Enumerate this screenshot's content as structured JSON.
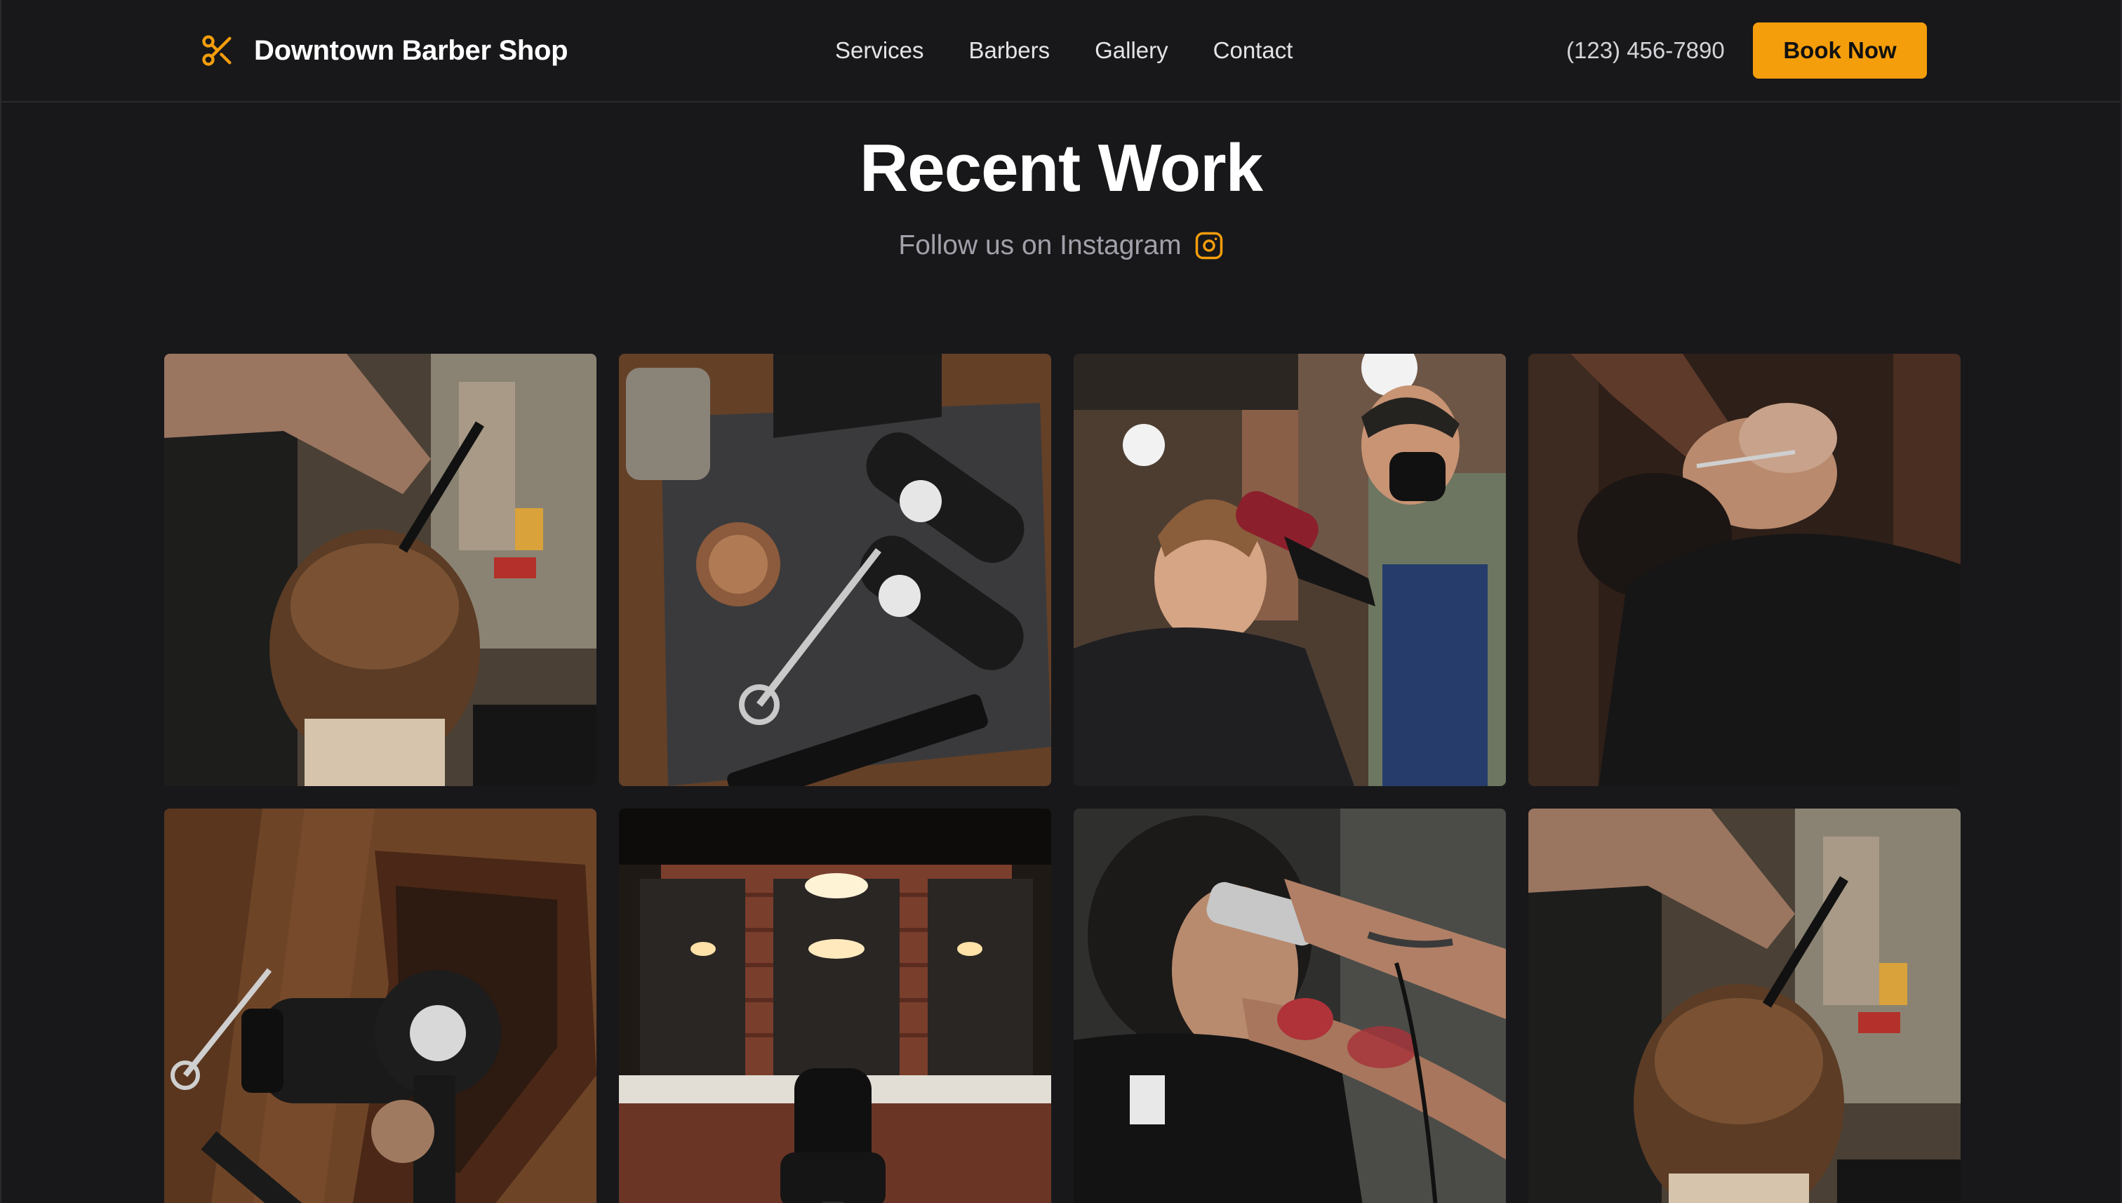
{
  "brand": {
    "name": "Downtown Barber Shop",
    "icon": "scissors-icon",
    "accent_color": "#f59e0b"
  },
  "nav": {
    "items": [
      "Services",
      "Barbers",
      "Gallery",
      "Contact"
    ]
  },
  "header": {
    "phone": "(123) 456-7890",
    "book_label": "Book Now"
  },
  "section": {
    "title": "Recent Work",
    "subtitle": "Follow us on Instagram",
    "subtitle_icon": "instagram-icon"
  },
  "gallery": {
    "images": [
      {
        "subject": "barber-cutting-hair-back-view"
      },
      {
        "subject": "clippers-scissors-comb-tools-flatlay"
      },
      {
        "subject": "masked-barber-blow-drying-client"
      },
      {
        "subject": "barber-shaving-beard-dark"
      },
      {
        "subject": "hair-dryer-in-wooden-box"
      },
      {
        "subject": "barbershop-interior-brick-wall-chair"
      },
      {
        "subject": "tattooed-barber-trimming-neck"
      },
      {
        "subject": "barber-cutting-hair-back-view"
      }
    ]
  }
}
